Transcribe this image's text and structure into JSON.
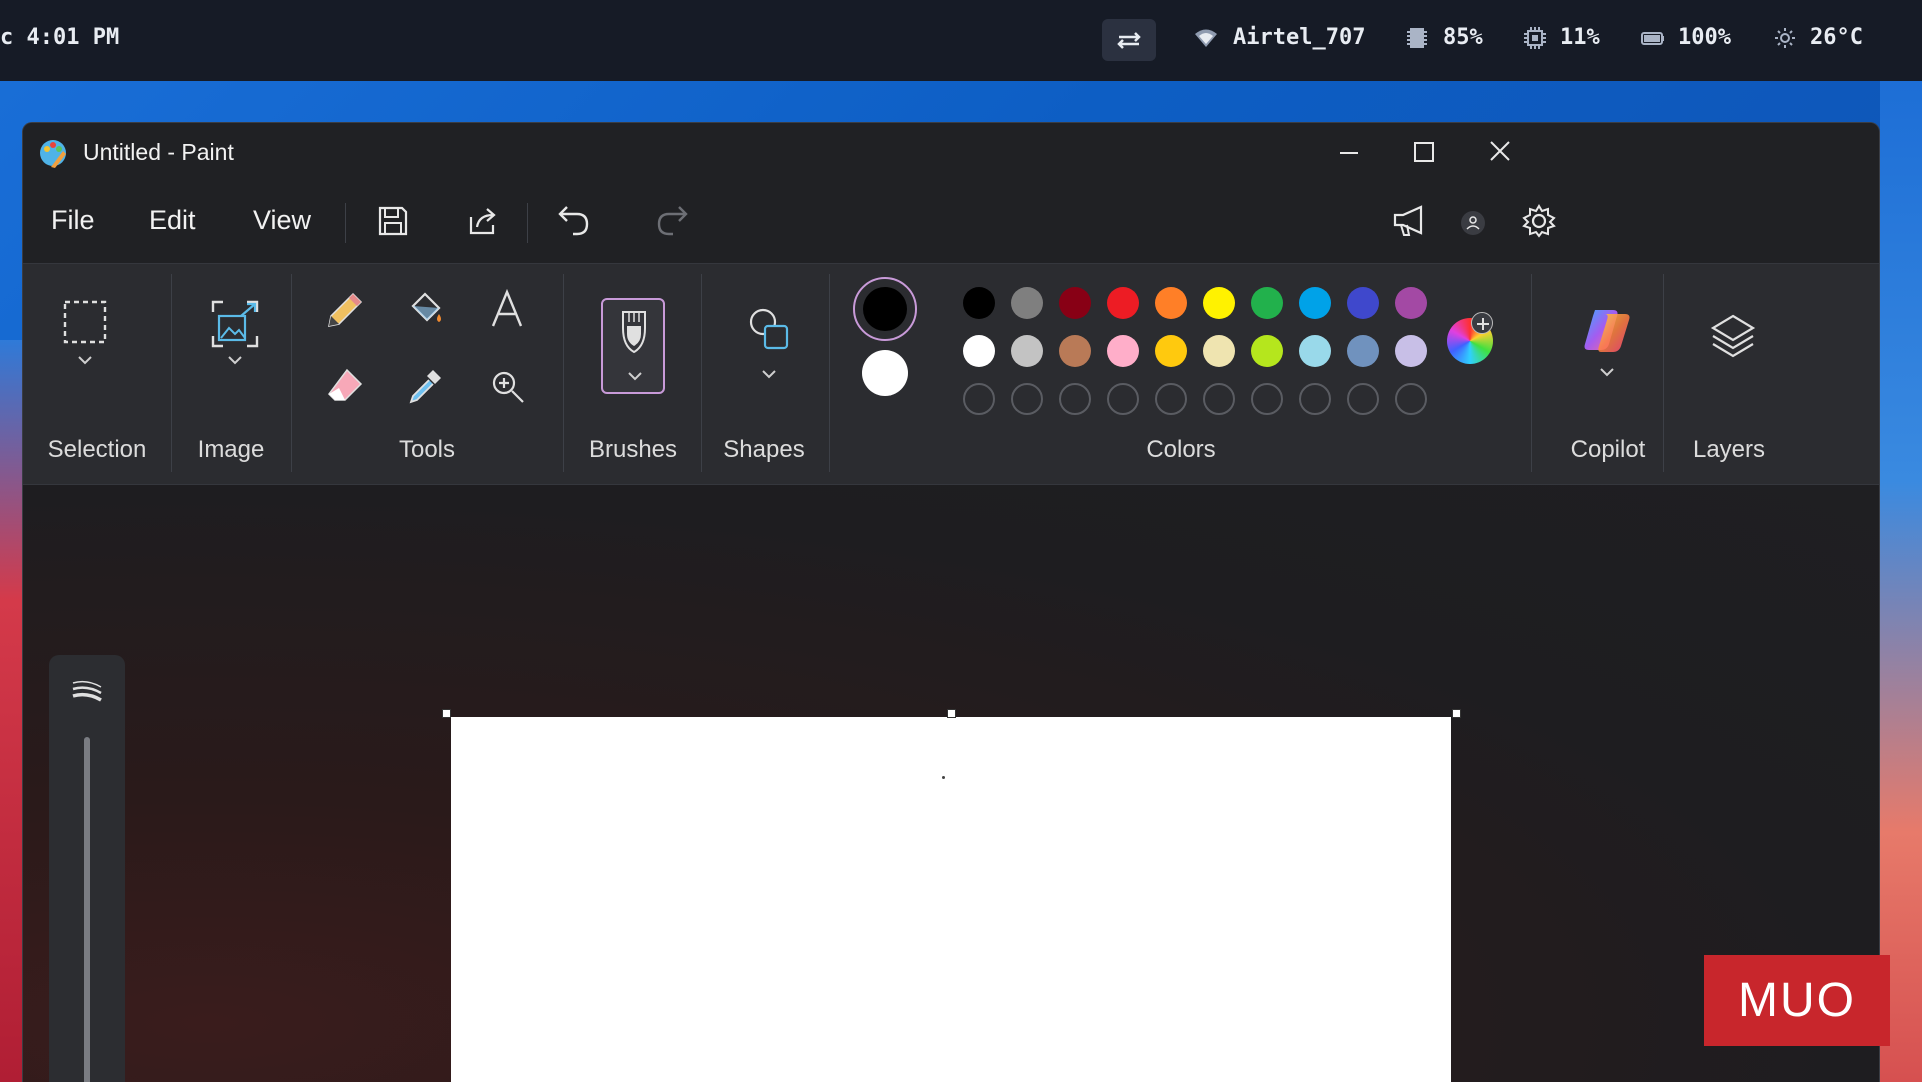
{
  "statusbar": {
    "time": "c 4:01 PM",
    "wifi": "Airtel_707",
    "memory": "85%",
    "cpu": "11%",
    "battery": "100%",
    "temperature": "26°C"
  },
  "window": {
    "title": "Untitled - Paint"
  },
  "menu": {
    "file": "File",
    "edit": "Edit",
    "view": "View"
  },
  "ribbon": {
    "selection": "Selection",
    "image": "Image",
    "tools": "Tools",
    "brushes": "Brushes",
    "shapes": "Shapes",
    "colors": "Colors",
    "copilot": "Copilot",
    "layers": "Layers"
  },
  "colors": {
    "primary": "#000000",
    "secondary": "#ffffff",
    "row1": [
      "#000000",
      "#7f7f7f",
      "#880015",
      "#ed1c24",
      "#ff7f27",
      "#fff200",
      "#22b14c",
      "#00a2e8",
      "#3f48cc",
      "#a349a4"
    ],
    "row2": [
      "#ffffff",
      "#c3c3c3",
      "#b97a57",
      "#ffaec9",
      "#ffc90e",
      "#efe4b0",
      "#b5e61d",
      "#99d9ea",
      "#7092be",
      "#c8bfe7"
    ],
    "custom_slots": 10
  },
  "watermark": "MUO"
}
